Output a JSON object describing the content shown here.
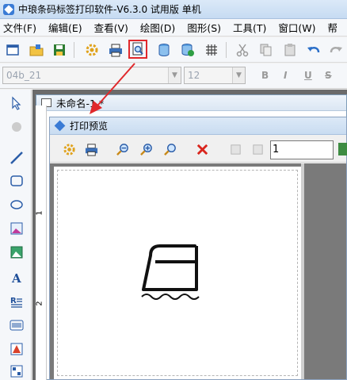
{
  "titlebar": {
    "title": "中琅条码标签打印软件-V6.3.0 试用版 单机"
  },
  "menu": [
    "文件(F)",
    "编辑(E)",
    "查看(V)",
    "绘图(D)",
    "图形(S)",
    "工具(T)",
    "窗口(W)",
    "帮"
  ],
  "toolbar": {
    "icons": [
      "new-icon",
      "open-icon",
      "save-icon",
      "settings-icon",
      "print-icon",
      "print-preview-icon",
      "database-icon",
      "database-settings-icon",
      "grid-icon",
      "cut-icon",
      "copy-icon",
      "paste-icon",
      "undo-icon",
      "redo-icon"
    ]
  },
  "format_bar": {
    "font_value": "04b_21",
    "size_value": "12",
    "bold": "B",
    "italic": "I",
    "underline": "U",
    "strike": "S"
  },
  "document": {
    "title": "未命名-1 *"
  },
  "preview": {
    "title": "打印预览",
    "page_value": "1",
    "ruler": [
      "1",
      "2"
    ]
  },
  "colors": {
    "highlight": "#e0282b",
    "arrow": "#e0282b"
  }
}
